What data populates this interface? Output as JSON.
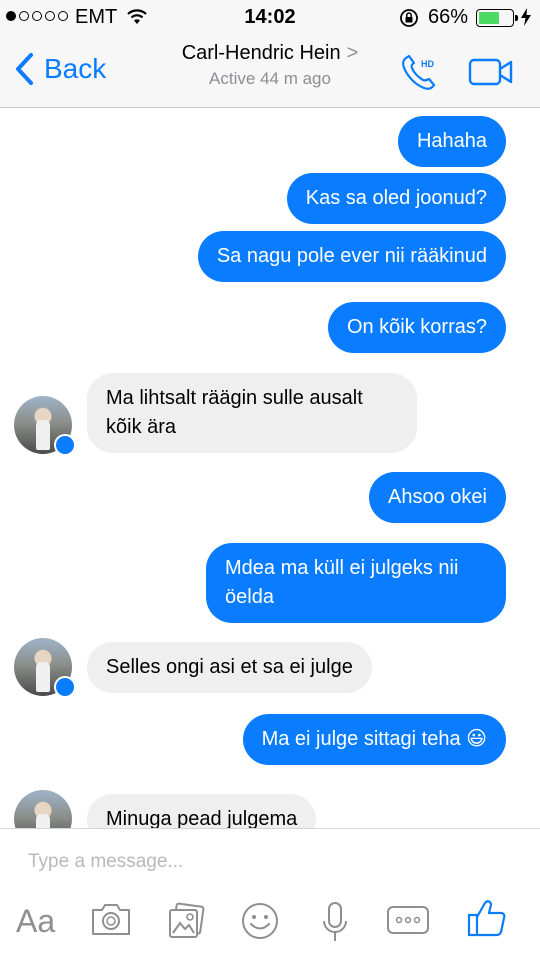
{
  "status_bar": {
    "carrier": "EMT",
    "time": "14:02",
    "battery_percent": "66%",
    "battery_level": 0.66,
    "signal_bars": 1
  },
  "header": {
    "back_label": "Back",
    "contact_name": "Carl-Hendric Hein",
    "contact_arrow": ">",
    "activity": "Active 44 m ago",
    "call_icon": "hd-phone-icon",
    "video_icon": "video-camera-icon",
    "accent": "#0a7cff"
  },
  "messages": [
    {
      "from": "me",
      "text": "Hahaha"
    },
    {
      "from": "me",
      "text": "Kas sa oled joonud?"
    },
    {
      "from": "me",
      "text": "Sa nagu pole ever nii rääkinud"
    },
    {
      "from": "me",
      "text": "On kõik korras?"
    },
    {
      "from": "them",
      "text": "Ma lihtsalt räägin sulle ausalt kõik ära"
    },
    {
      "from": "me",
      "text": "Ahsoo okei"
    },
    {
      "from": "me",
      "text": "Mdea ma küll ei julgeks nii öelda"
    },
    {
      "from": "them",
      "text": "Selles ongi asi et sa ei julge"
    },
    {
      "from": "me",
      "text": "Ma ei julge sittagi teha 😃"
    },
    {
      "from": "them",
      "text": "Minuga pead julgema"
    }
  ],
  "composer": {
    "placeholder": "Type a message...",
    "aa_label": "Aa",
    "tools": [
      "camera-icon",
      "photo-gallery-icon",
      "emoji-icon",
      "microphone-icon",
      "more-icon",
      "like-thumb-icon"
    ]
  }
}
